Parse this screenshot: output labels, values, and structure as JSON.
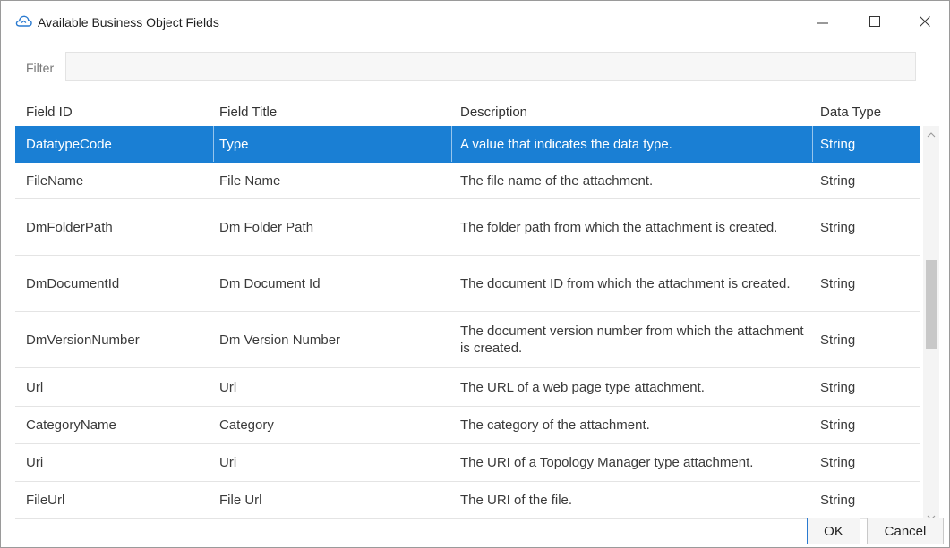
{
  "window": {
    "title": "Available Business Object Fields"
  },
  "filter": {
    "label": "Filter",
    "value": "",
    "placeholder": ""
  },
  "table": {
    "columns": [
      "Field ID",
      "Field Title",
      "Description",
      "Data Type"
    ],
    "rows": [
      {
        "id": "DatatypeCode",
        "title": "Type",
        "description": "A value that indicates the data type.",
        "type": "String",
        "selected": true
      },
      {
        "id": "FileName",
        "title": "File Name",
        "description": "The file name of the attachment.",
        "type": "String"
      },
      {
        "id": "DmFolderPath",
        "title": "Dm Folder Path",
        "description": "The folder path from which the attachment is created.",
        "type": "String"
      },
      {
        "id": "DmDocumentId",
        "title": "Dm Document Id",
        "description": "The document ID from which the attachment is created.",
        "type": "String"
      },
      {
        "id": "DmVersionNumber",
        "title": "Dm Version Number",
        "description": "The document version number from which the attachment is created.",
        "type": "String"
      },
      {
        "id": "Url",
        "title": "Url",
        "description": "The URL of a web page type attachment.",
        "type": "String"
      },
      {
        "id": "CategoryName",
        "title": "Category",
        "description": "The category of the attachment.",
        "type": "String"
      },
      {
        "id": "Uri",
        "title": "Uri",
        "description": "The URI of a Topology Manager type attachment.",
        "type": "String"
      },
      {
        "id": "FileUrl",
        "title": "File Url",
        "description": "The URI of the file.",
        "type": "String"
      }
    ]
  },
  "buttons": {
    "ok": "OK",
    "cancel": "Cancel"
  },
  "icons": {
    "app": "cloud-icon",
    "minimize": "minimize-icon",
    "maximize": "maximize-icon",
    "close": "close-icon",
    "scroll_up": "chevron-up-icon",
    "scroll_down": "chevron-down-icon"
  },
  "colors": {
    "selection": "#1a7fd4",
    "accent": "#2a7ad0"
  }
}
